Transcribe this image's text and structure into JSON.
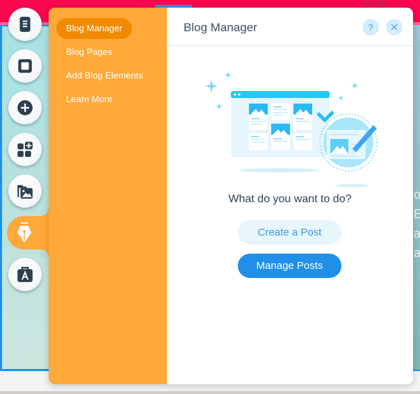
{
  "background": {
    "site_nav_label": "HOME",
    "side_text_fragments": [
      "o",
      "E",
      "a",
      "a"
    ]
  },
  "rail": {
    "items": [
      {
        "name": "pages-icon",
        "label": "Pages"
      },
      {
        "name": "background-icon",
        "label": "Background"
      },
      {
        "name": "add-icon",
        "label": "Add"
      },
      {
        "name": "app-market-icon",
        "label": "Add Apps"
      },
      {
        "name": "media-icon",
        "label": "Media"
      },
      {
        "name": "blog-pen-icon",
        "label": "Blog",
        "active": true
      },
      {
        "name": "portfolio-icon",
        "label": "My Business"
      }
    ]
  },
  "panel": {
    "nav": {
      "items": [
        {
          "label": "Blog Manager",
          "active": true
        },
        {
          "label": "Blog Pages",
          "active": false
        },
        {
          "label": "Add Blog Elements",
          "active": false
        },
        {
          "label": "Learn More",
          "active": false
        }
      ]
    },
    "header": {
      "title": "Blog Manager",
      "help_label": "?",
      "close_icon": "close-icon"
    },
    "main": {
      "question": "What do you want to do?",
      "create_button": "Create a Post",
      "manage_button": "Manage Posts"
    }
  },
  "colors": {
    "accent_orange": "#fea93a",
    "active_orange": "#f28a00",
    "primary_blue": "#1f8fe9",
    "light_blue": "#e7f5fd",
    "top_bar_pink": "#f7084f"
  }
}
